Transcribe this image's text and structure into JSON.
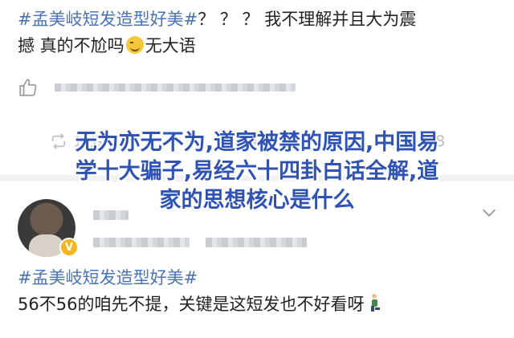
{
  "post": {
    "hashtag": "#孟美岐短发造型好美#",
    "text_line1_rest": "？ ？ ？ 我不理解并且大为震",
    "text_line2": "撼 真的不尬吗",
    "text_line2_tail": "无大语",
    "emoji": "grinning-sweat-emoji"
  },
  "actions": {
    "repost_label": "转发",
    "comment_label": "评论",
    "like_count": "28"
  },
  "overlay": {
    "line1": "无为亦无不为,道家被禁的原因,中国易",
    "line2": "学十大骗子,易经六十四卦白话全解,道",
    "line3": "家的思想核心是什么"
  },
  "comment": {
    "badge": "V",
    "hashtag": "#孟美岐短发造型好美#",
    "text": "56不56的咱先不提，关键是这短发也不好看呀"
  },
  "colors": {
    "hashtag": "#4a73b3",
    "overlay_text": "#2f53b4",
    "muted_icon": "#bdbdbd",
    "verified_badge": "#f5b520"
  }
}
